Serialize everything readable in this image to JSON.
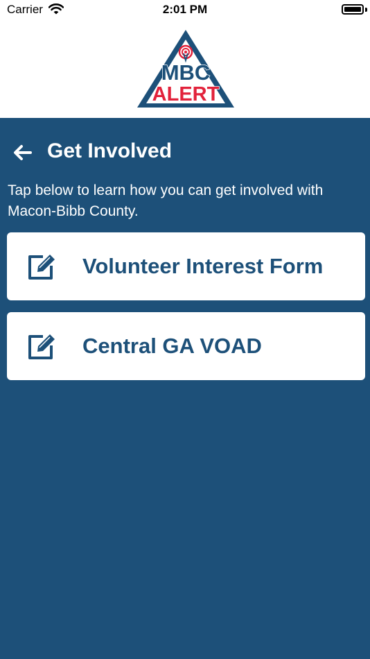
{
  "status_bar": {
    "carrier": "Carrier",
    "time": "2:01 PM"
  },
  "logo": {
    "line1": "MBC",
    "line2": "ALERT"
  },
  "header": {
    "title": "Get Involved",
    "back_icon": "arrow-left-icon"
  },
  "intro_text": "Tap below to learn how you can get involved with Macon-Bibb County.",
  "links": [
    {
      "label": "Volunteer Interest Form",
      "icon": "edit-icon"
    },
    {
      "label": "Central GA VOAD",
      "icon": "edit-icon"
    }
  ],
  "colors": {
    "primary": "#1d5079",
    "alert_red": "#e2223b",
    "white": "#ffffff"
  }
}
